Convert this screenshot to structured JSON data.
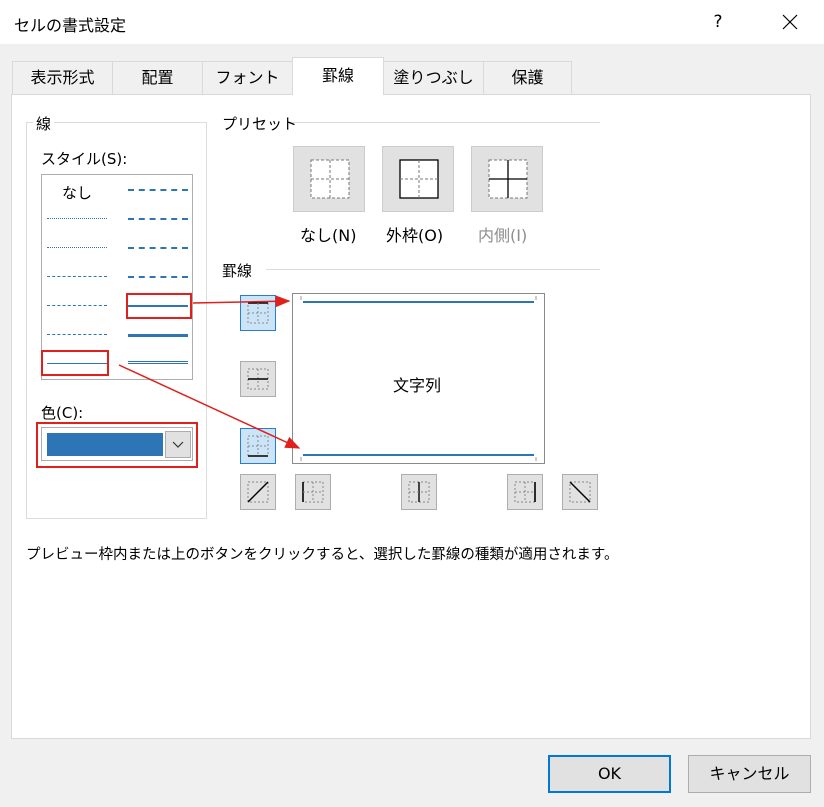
{
  "window": {
    "title": "セルの書式設定",
    "help": "?",
    "close": "✕"
  },
  "tabs": [
    {
      "label": "表示形式"
    },
    {
      "label": "配置"
    },
    {
      "label": "フォント"
    },
    {
      "label": "罫線"
    },
    {
      "label": "塗りつぶし"
    },
    {
      "label": "保護"
    }
  ],
  "active_tab": "罫線",
  "line_group": {
    "label": "線",
    "style_label": "スタイル(S):",
    "none_label": "なし",
    "color_label": "色(C):",
    "color_value": "#2e75b6"
  },
  "presets": {
    "label": "プリセット",
    "buttons": [
      {
        "label": "なし(N)",
        "enabled": true
      },
      {
        "label": "外枠(O)",
        "enabled": true
      },
      {
        "label": "内側(I)",
        "enabled": false
      }
    ]
  },
  "border_group": {
    "label": "罫線",
    "preview_text": "文字列"
  },
  "hint": "プレビュー枠内または上のボタンをクリックすると、選択した罫線の種類が適用されます。",
  "footer": {
    "ok": "OK",
    "cancel": "キャンセル"
  },
  "colors": {
    "accent": "#2e75b6",
    "annotation": "#e0201c",
    "selected_btn": "#cce4f7"
  }
}
